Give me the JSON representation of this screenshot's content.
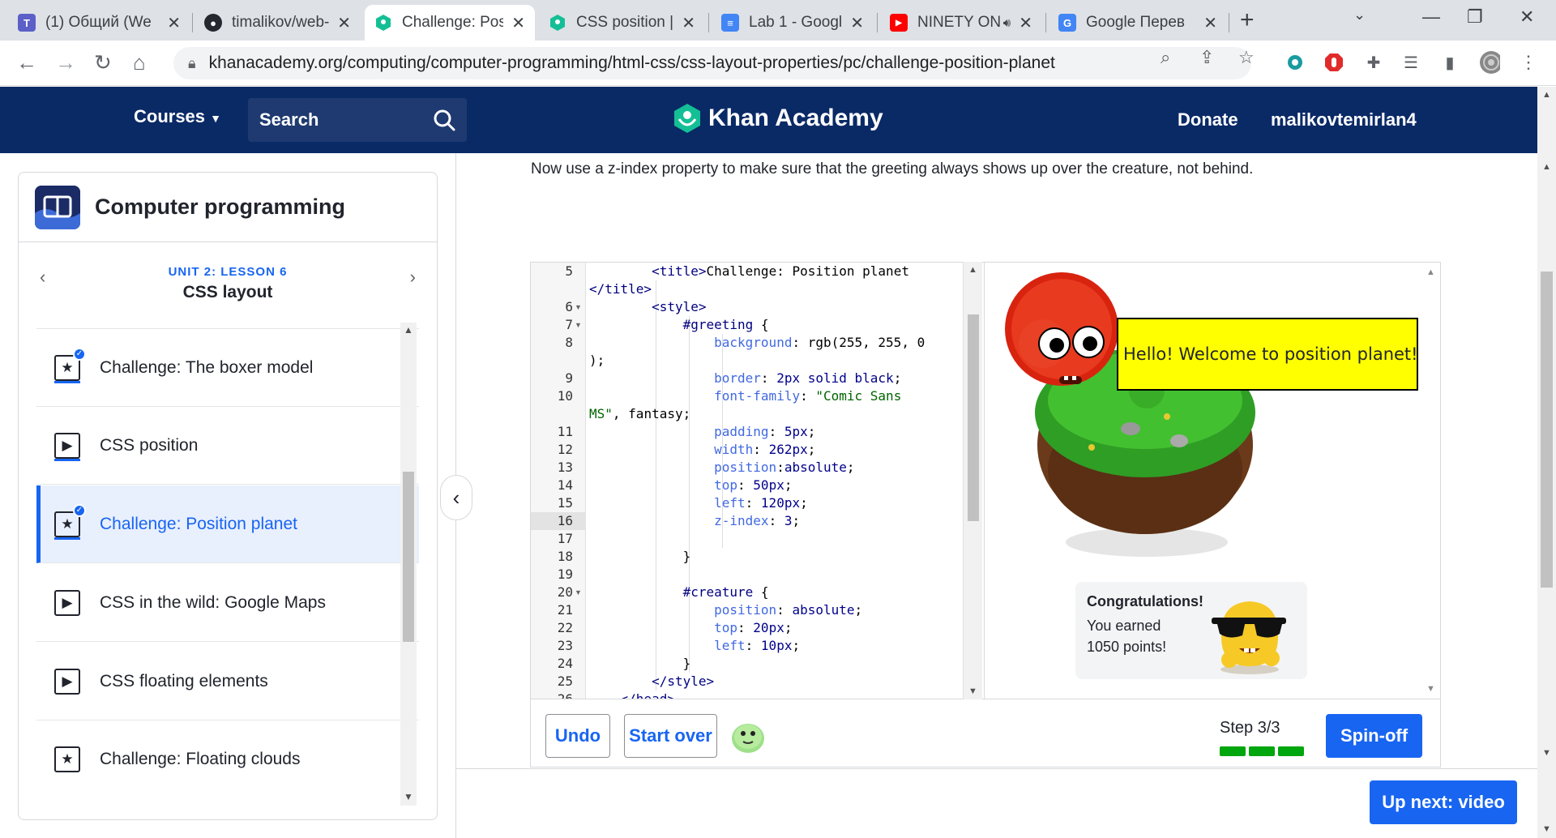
{
  "browser": {
    "tabs": [
      {
        "title": "(1) Общий (We",
        "icon": "teams-icon",
        "color": "#5b5fc7"
      },
      {
        "title": "timalikov/web-",
        "icon": "github-icon",
        "color": "#24292f"
      },
      {
        "title": "Challenge: Pos",
        "icon": "khan-academy-icon",
        "color": "#14bf96",
        "active": true
      },
      {
        "title": "CSS position | (",
        "icon": "khan-academy-icon",
        "color": "#14bf96"
      },
      {
        "title": "Lab 1 - Google",
        "icon": "google-docs-icon",
        "color": "#4285f4"
      },
      {
        "title": "NINETY ON",
        "icon": "youtube-icon",
        "color": "#ff0000"
      },
      {
        "title": "Google Перев",
        "icon": "google-translate-icon",
        "color": "#4285f4"
      }
    ],
    "new_tab": "+",
    "url": "khanacademy.org/computing/computer-programming/html-css/css-layout-properties/pc/challenge-position-planet"
  },
  "header": {
    "courses": "Courses",
    "search": "Search",
    "logo": "Khan Academy",
    "donate": "Donate",
    "user": "malikovtemirlan4",
    "background": "#0a2a66"
  },
  "sidebar": {
    "course_title": "Computer programming",
    "unit": "UNIT 2: LESSON 6",
    "lesson": "CSS layout",
    "items": [
      {
        "label": "Challenge: The boxer model",
        "icon": "star",
        "done": true
      },
      {
        "label": "CSS position",
        "icon": "play",
        "done": false
      },
      {
        "label": "Challenge: Position planet",
        "icon": "star",
        "done": true,
        "active": true
      },
      {
        "label": "CSS in the wild: Google Maps",
        "icon": "play",
        "done": false
      },
      {
        "label": "CSS floating elements",
        "icon": "play",
        "done": false
      },
      {
        "label": "Challenge: Floating clouds",
        "icon": "star",
        "done": false
      }
    ]
  },
  "main": {
    "instruction": "Now use a z-index property to make sure that the greeting always shows up over the creature, not behind.",
    "line_numbers": [
      "5",
      "",
      "6",
      "7",
      "8",
      "",
      "9",
      "10",
      "",
      "11",
      "12",
      "13",
      "14",
      "15",
      "16",
      "17",
      "18",
      "19",
      "20",
      "21",
      "22",
      "23",
      "24",
      "25",
      "26"
    ],
    "greeting_text": "Hello! Welcome to position planet!",
    "congrats_title": "Congratulations!",
    "congrats_body": "You earned 1050 points!",
    "undo": "Undo",
    "start_over": "Start over",
    "step": "Step 3/3",
    "steps_completed": 3,
    "steps_total": 3,
    "spinoff": "Spin-off",
    "up_next": "Up next: video"
  }
}
